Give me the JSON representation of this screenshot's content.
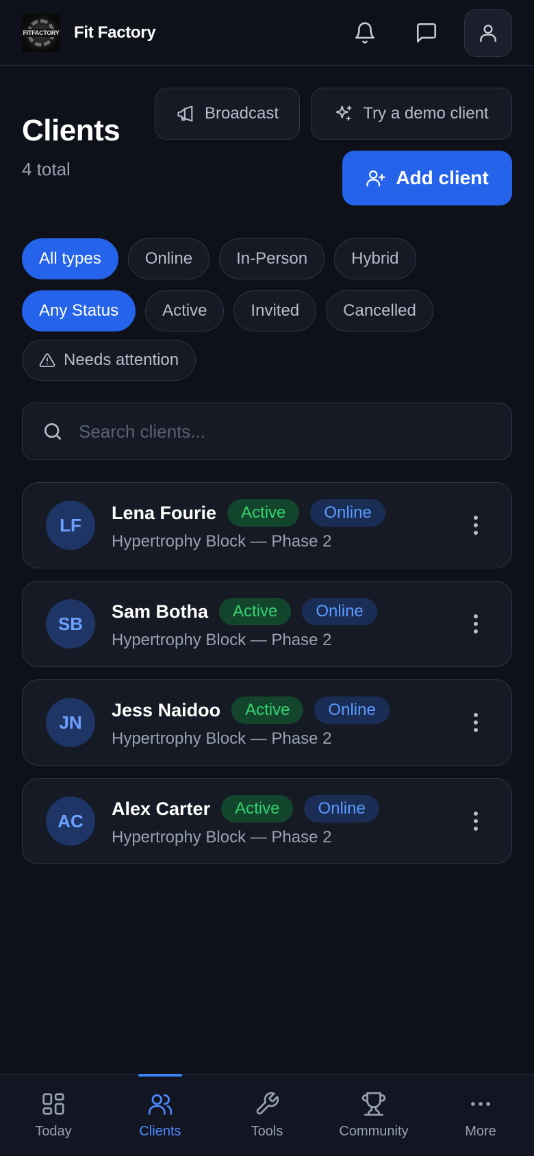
{
  "header": {
    "logo_text": "FITFACTORY",
    "brand": "Fit Factory"
  },
  "page": {
    "title": "Clients",
    "subtitle": "4 total"
  },
  "actions": {
    "broadcast": "Broadcast",
    "demo": "Try a demo client",
    "add": "Add client"
  },
  "filters": {
    "types": [
      "All types",
      "Online",
      "In-Person",
      "Hybrid"
    ],
    "status": [
      "Any Status",
      "Active",
      "Invited",
      "Cancelled"
    ],
    "attention": "Needs attention",
    "selected_type": "All types",
    "selected_status": "Any Status"
  },
  "search": {
    "placeholder": "Search clients..."
  },
  "clients": [
    {
      "initials": "LF",
      "name": "Lena Fourie",
      "status": "Active",
      "type": "Online",
      "program": "Hypertrophy Block — Phase 2"
    },
    {
      "initials": "SB",
      "name": "Sam Botha",
      "status": "Active",
      "type": "Online",
      "program": "Hypertrophy Block — Phase 2"
    },
    {
      "initials": "JN",
      "name": "Jess Naidoo",
      "status": "Active",
      "type": "Online",
      "program": "Hypertrophy Block — Phase 2"
    },
    {
      "initials": "AC",
      "name": "Alex Carter",
      "status": "Active",
      "type": "Online",
      "program": "Hypertrophy Block — Phase 2"
    }
  ],
  "nav": [
    {
      "label": "Today",
      "icon": "grid-icon"
    },
    {
      "label": "Clients",
      "icon": "users-icon"
    },
    {
      "label": "Tools",
      "icon": "wrench-icon"
    },
    {
      "label": "Community",
      "icon": "trophy-icon"
    },
    {
      "label": "More",
      "icon": "more-icon"
    }
  ],
  "nav_active": "Clients",
  "colors": {
    "background": "#0e111a",
    "accent": "#2563eb",
    "active_badge": "#34d36f",
    "online_badge": "#5b9bff"
  }
}
